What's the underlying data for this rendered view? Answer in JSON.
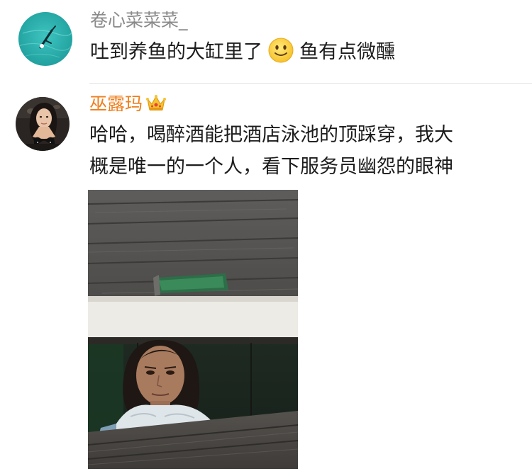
{
  "comments": [
    {
      "username": "卷心菜菜菜_",
      "text_before_emoji": "吐到养鱼的大缸里了",
      "emoji": "slightly-smiling-face-icon",
      "text_after_emoji": "鱼有点微醺"
    },
    {
      "username": "巫露玛",
      "badge": "crown-icon",
      "text_line1": "哈哈，喝醉酒能把酒店泳池的顶踩穿，我大",
      "text_line2": "概是唯一的一个人，看下服务员幽怨的眼神",
      "attached_image": "photo-wooden-deck-hole-and-woman-in-water"
    }
  ],
  "colors": {
    "username_default": "#8a8a8a",
    "username_vip": "#ef7e1b",
    "text": "#1c1c1c",
    "divider": "#e4e4e4"
  }
}
